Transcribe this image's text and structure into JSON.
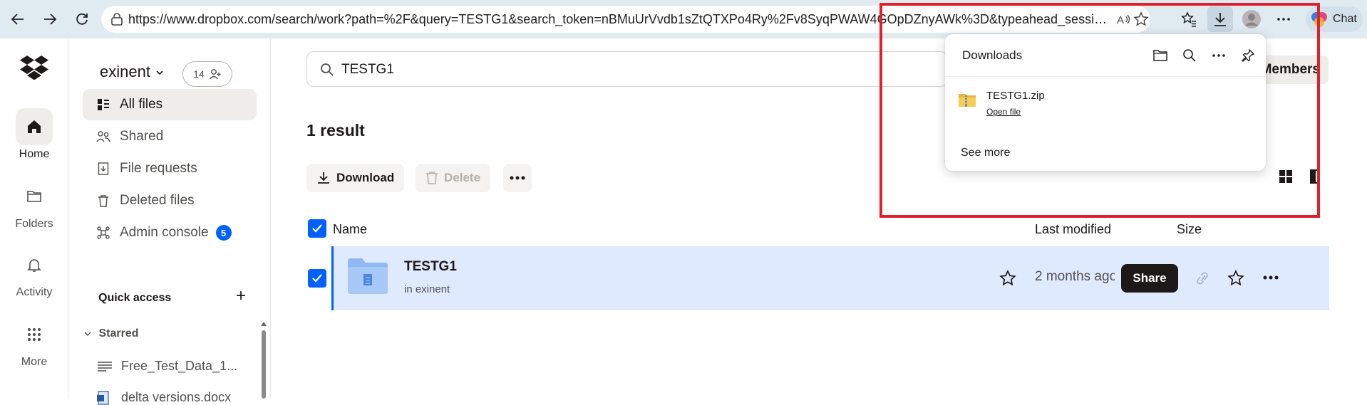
{
  "browser": {
    "url": "https://www.dropbox.com/search/work?path=%2F&query=TESTG1&search_token=nBMuUrVvdb1sZtQTXPo4Ry%2Fv8SyqPWAW4GOpDZnyAWk%3D&typeahead_session_id=863...",
    "chat_label": "Chat"
  },
  "rail": {
    "items": [
      {
        "label": "Home",
        "icon": "home-icon"
      },
      {
        "label": "Folders",
        "icon": "folder-icon"
      },
      {
        "label": "Activity",
        "icon": "bell-icon"
      },
      {
        "label": "More",
        "icon": "grid-icon"
      }
    ]
  },
  "sidebar": {
    "team_name": "exinent",
    "member_count": "14",
    "items": [
      {
        "label": "All files",
        "icon": "all-files-icon"
      },
      {
        "label": "Shared",
        "icon": "shared-icon"
      },
      {
        "label": "File requests",
        "icon": "file-request-icon"
      },
      {
        "label": "Deleted files",
        "icon": "trash-icon"
      },
      {
        "label": "Admin console",
        "icon": "admin-icon",
        "badge": "5"
      }
    ],
    "quick_access": "Quick access",
    "starred": "Starred",
    "starred_files": [
      "Free_Test_Data_1...",
      "delta versions.docx"
    ]
  },
  "main": {
    "search_value": "TESTG1",
    "members_label": "Members",
    "results_count": "1 result",
    "actions": {
      "download": "Download",
      "delete": "Delete"
    },
    "columns": {
      "name": "Name",
      "modified": "Last modified",
      "size": "Size"
    },
    "rows": [
      {
        "name": "TESTG1",
        "location": "in exinent",
        "modified": "2 months ago",
        "share_label": "Share"
      }
    ]
  },
  "downloads": {
    "title": "Downloads",
    "file_name": "TESTG1.zip",
    "open_label": "Open file",
    "see_more": "See more"
  },
  "colors": {
    "accent": "#0061fe",
    "highlight": "#e0202a",
    "row_selected": "#dfeaff"
  }
}
